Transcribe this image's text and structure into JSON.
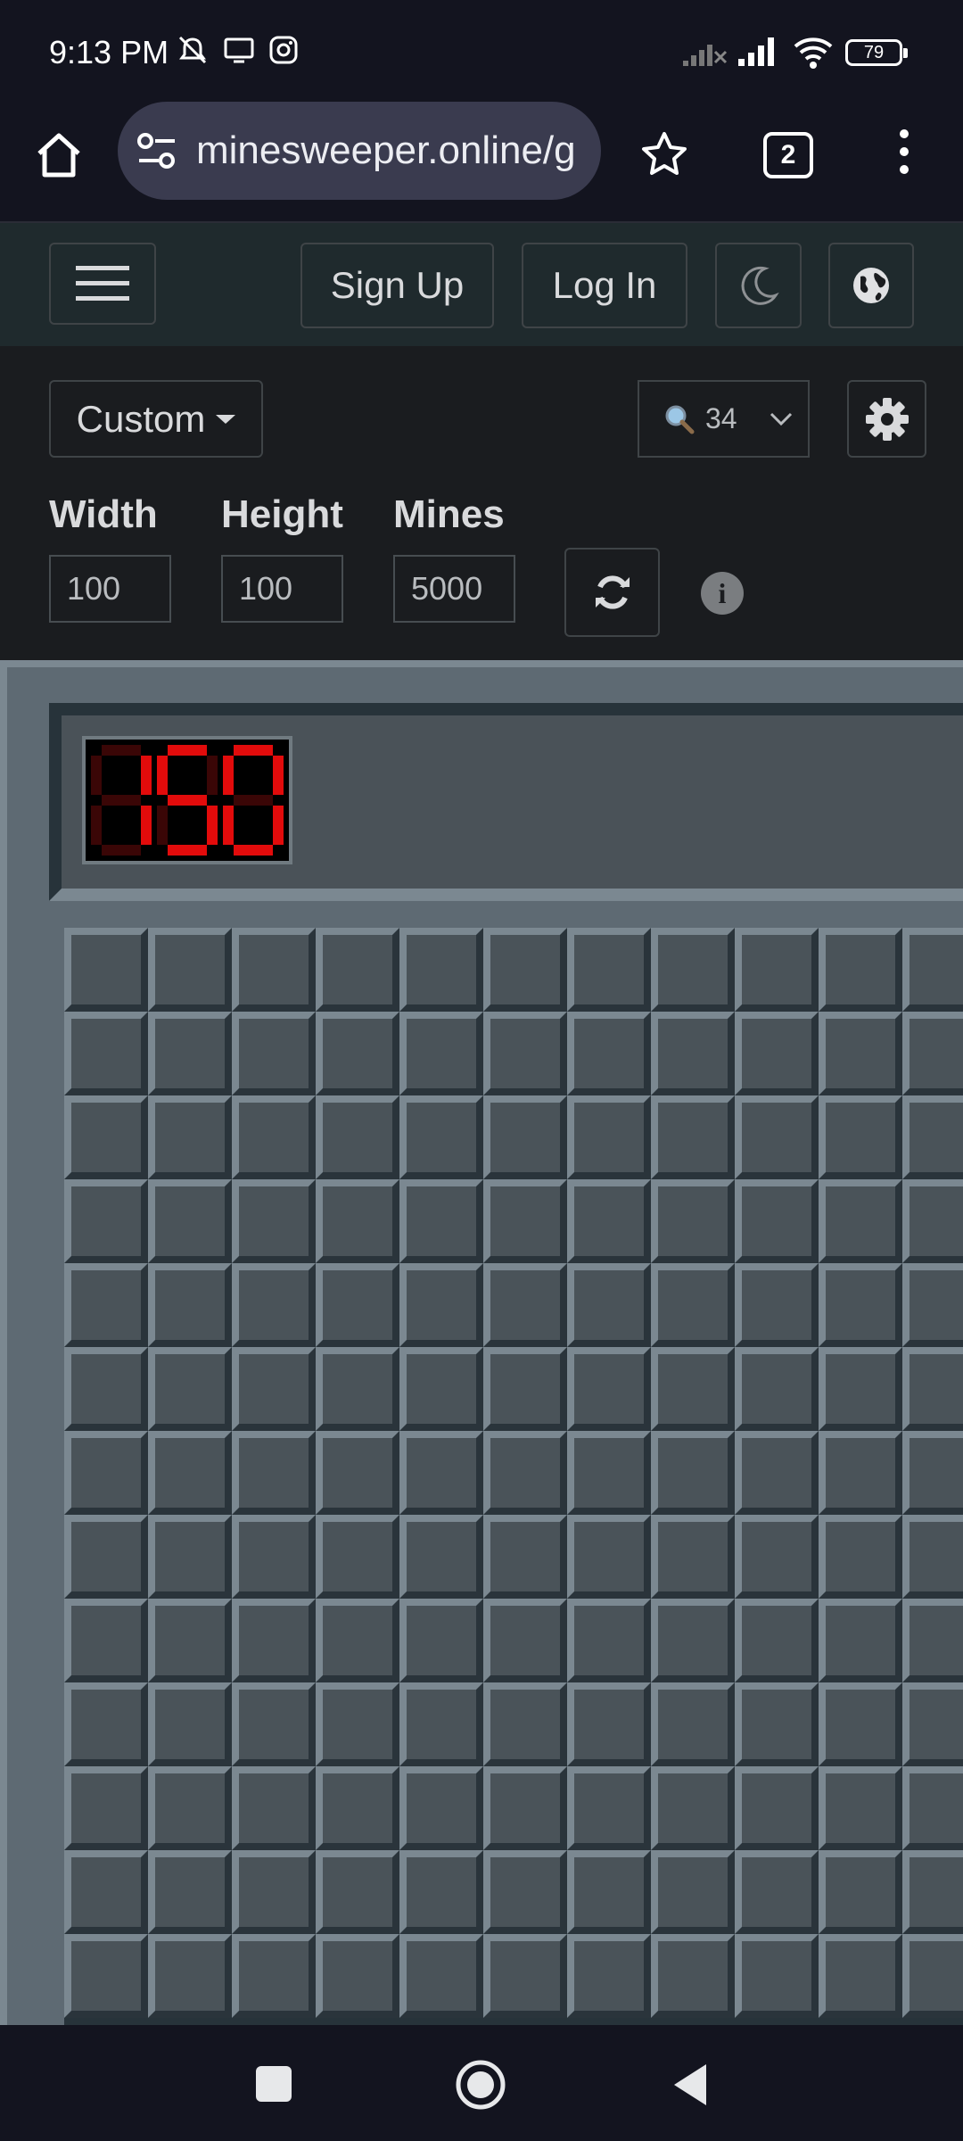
{
  "status_bar": {
    "time": "9:13 PM",
    "battery": "79"
  },
  "browser": {
    "url": "minesweeper.online/g",
    "tab_count": "2"
  },
  "nav": {
    "signup_label": "Sign Up",
    "login_label": "Log In"
  },
  "controls": {
    "level_label": "Custom",
    "zoom_value": "34",
    "width_label": "Width",
    "width_value": "100",
    "height_label": "Height",
    "height_value": "100",
    "mines_label": "Mines",
    "mines_value": "5000",
    "info_glyph": "i"
  },
  "game": {
    "mine_counter": "150",
    "visible_cols": 11,
    "visible_rows": 13
  },
  "colors": {
    "led_on": "#e20b0b",
    "led_off": "#3a0606",
    "cell": "#4a5359"
  }
}
